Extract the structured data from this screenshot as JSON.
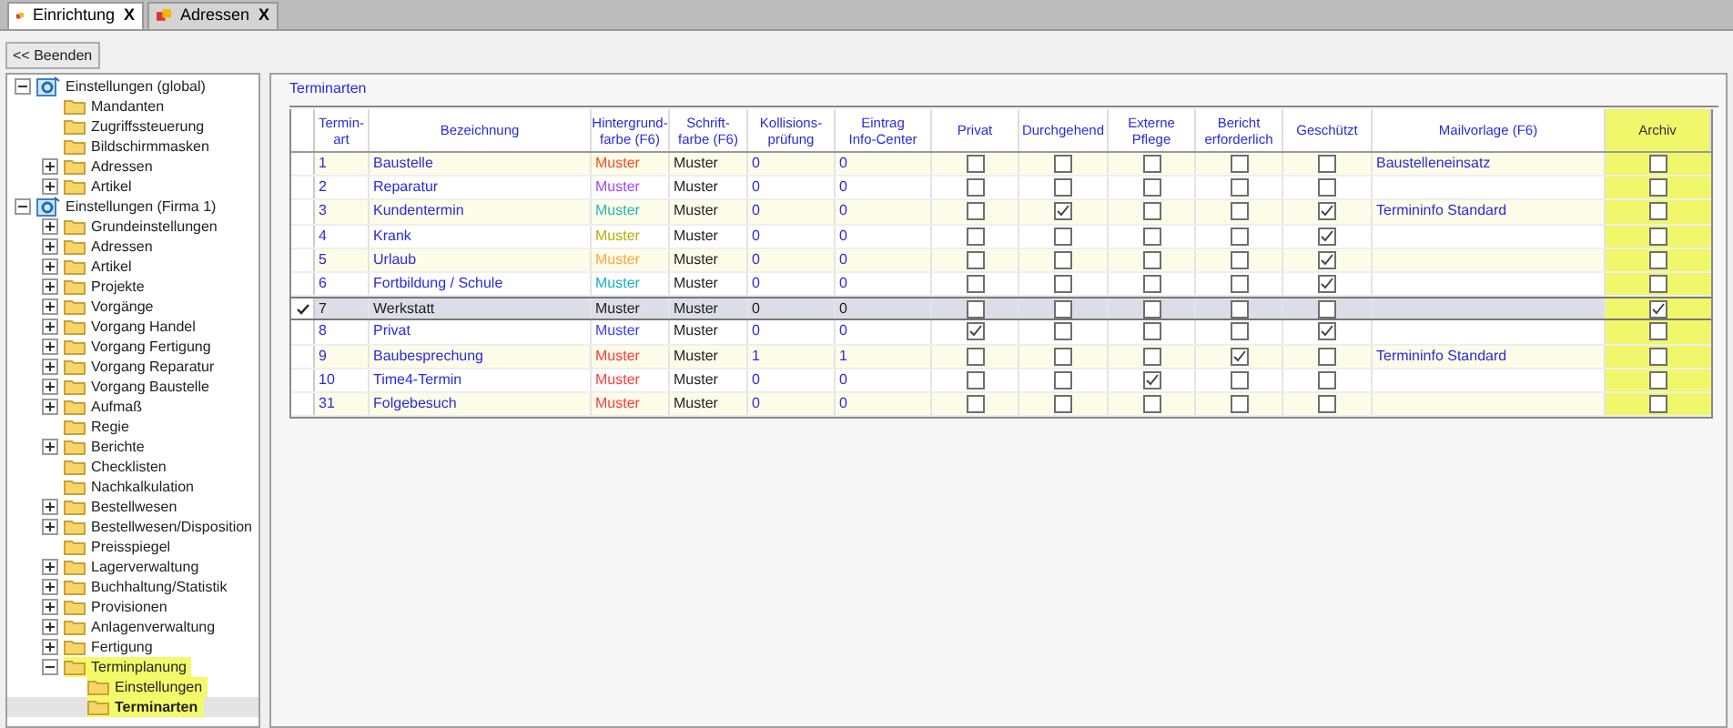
{
  "tabs": [
    {
      "label": "Einrichtung",
      "close": "X",
      "selected": true
    },
    {
      "label": "Adressen",
      "close": "X",
      "selected": false
    }
  ],
  "back_button": "<< Beenden",
  "tree": [
    {
      "label": "Einstellungen (global)",
      "kind": "root",
      "expanded": true,
      "selected": false,
      "highlighted": false,
      "children": [
        {
          "label": "Mandanten",
          "kind": "folder",
          "selected": false,
          "highlighted": false
        },
        {
          "label": "Zugriffssteuerung",
          "kind": "folder",
          "selected": false,
          "highlighted": false
        },
        {
          "label": "Bildschirmmasken",
          "kind": "folder",
          "selected": false,
          "highlighted": false
        },
        {
          "label": "Adressen",
          "kind": "folder",
          "expanded": false,
          "selected": false,
          "highlighted": false
        },
        {
          "label": "Artikel",
          "kind": "folder",
          "expanded": false,
          "selected": false,
          "highlighted": false
        }
      ]
    },
    {
      "label": "Einstellungen (Firma 1)",
      "kind": "root",
      "expanded": true,
      "selected": false,
      "highlighted": false,
      "children": [
        {
          "label": "Grundeinstellungen",
          "kind": "folder",
          "expanded": false,
          "selected": false,
          "highlighted": false
        },
        {
          "label": "Adressen",
          "kind": "folder",
          "expanded": false,
          "selected": false,
          "highlighted": false
        },
        {
          "label": "Artikel",
          "kind": "folder",
          "expanded": false,
          "selected": false,
          "highlighted": false
        },
        {
          "label": "Projekte",
          "kind": "folder",
          "expanded": false,
          "selected": false,
          "highlighted": false
        },
        {
          "label": "Vorgänge",
          "kind": "folder",
          "expanded": false,
          "selected": false,
          "highlighted": false
        },
        {
          "label": "Vorgang Handel",
          "kind": "folder",
          "expanded": false,
          "selected": false,
          "highlighted": false
        },
        {
          "label": "Vorgang Fertigung",
          "kind": "folder",
          "expanded": false,
          "selected": false,
          "highlighted": false
        },
        {
          "label": "Vorgang Reparatur",
          "kind": "folder",
          "expanded": false,
          "selected": false,
          "highlighted": false
        },
        {
          "label": "Vorgang Baustelle",
          "kind": "folder",
          "expanded": false,
          "selected": false,
          "highlighted": false
        },
        {
          "label": "Aufmaß",
          "kind": "folder",
          "expanded": false,
          "selected": false,
          "highlighted": false
        },
        {
          "label": "Regie",
          "kind": "folder",
          "selected": false,
          "highlighted": false
        },
        {
          "label": "Berichte",
          "kind": "folder",
          "expanded": false,
          "selected": false,
          "highlighted": false
        },
        {
          "label": "Checklisten",
          "kind": "folder",
          "selected": false,
          "highlighted": false
        },
        {
          "label": "Nachkalkulation",
          "kind": "folder",
          "selected": false,
          "highlighted": false
        },
        {
          "label": "Bestellwesen",
          "kind": "folder",
          "expanded": false,
          "selected": false,
          "highlighted": false
        },
        {
          "label": "Bestellwesen/Disposition",
          "kind": "folder",
          "expanded": false,
          "selected": false,
          "highlighted": false
        },
        {
          "label": "Preisspiegel",
          "kind": "folder",
          "selected": false,
          "highlighted": false
        },
        {
          "label": "Lagerverwaltung",
          "kind": "folder",
          "expanded": false,
          "selected": false,
          "highlighted": false
        },
        {
          "label": "Buchhaltung/Statistik",
          "kind": "folder",
          "expanded": false,
          "selected": false,
          "highlighted": false
        },
        {
          "label": "Provisionen",
          "kind": "folder",
          "expanded": false,
          "selected": false,
          "highlighted": false
        },
        {
          "label": "Anlagenverwaltung",
          "kind": "folder",
          "expanded": false,
          "selected": false,
          "highlighted": false
        },
        {
          "label": "Fertigung",
          "kind": "folder",
          "expanded": false,
          "selected": false,
          "highlighted": false
        },
        {
          "label": "Terminplanung",
          "kind": "folder",
          "expanded": true,
          "selected": false,
          "highlighted": true,
          "children": [
            {
              "label": "Einstellungen",
              "kind": "folder",
              "selected": false,
              "highlighted": true
            },
            {
              "label": "Terminarten",
              "kind": "folder",
              "selected": true,
              "highlighted": true
            }
          ]
        }
      ]
    }
  ],
  "grid": {
    "title": "Terminarten",
    "columns": [
      {
        "label": "Termin-\nart",
        "highlighted": false
      },
      {
        "label": "Bezeichnung",
        "highlighted": false
      },
      {
        "label": "Hintergrund-\nfarbe (F6)",
        "highlighted": false
      },
      {
        "label": "Schrift-\nfarbe (F6)",
        "highlighted": false
      },
      {
        "label": "Kollisions-\nprüfung",
        "highlighted": false
      },
      {
        "label": "Eintrag\nInfo-Center",
        "highlighted": false
      },
      {
        "label": "Privat",
        "highlighted": false
      },
      {
        "label": "Durchgehend",
        "highlighted": false
      },
      {
        "label": "Externe\nPflege",
        "highlighted": false
      },
      {
        "label": "Bericht\nerforderlich",
        "highlighted": false
      },
      {
        "label": "Geschützt",
        "highlighted": false
      },
      {
        "label": "Mailvorlage (F6)",
        "highlighted": false
      },
      {
        "label": "Archiv",
        "highlighted": true
      }
    ],
    "rows": [
      {
        "nr": "1",
        "name": "Baustelle",
        "bg": {
          "text": "Muster",
          "color": "#ff4a1c"
        },
        "font": {
          "text": "Muster",
          "color": "#222222"
        },
        "kollision": "0",
        "info": "0",
        "checks": [
          false,
          false,
          false,
          false,
          false,
          false
        ],
        "mail": "Baustelleneinsatz",
        "selected": false
      },
      {
        "nr": "2",
        "name": "Reparatur",
        "bg": {
          "text": "Muster",
          "color": "#a347ff"
        },
        "font": {
          "text": "Muster",
          "color": "#222222"
        },
        "kollision": "0",
        "info": "0",
        "checks": [
          false,
          false,
          false,
          false,
          false,
          false
        ],
        "selected": false
      },
      {
        "nr": "3",
        "name": "Kundentermin",
        "bg": {
          "text": "Muster",
          "color": "#1fb8b8"
        },
        "font": {
          "text": "Muster",
          "color": "#222222"
        },
        "kollision": "0",
        "info": "0",
        "checks": [
          false,
          true,
          false,
          false,
          true,
          false
        ],
        "mail": "Termininfo Standard",
        "selected": false
      },
      {
        "nr": "4",
        "name": "Krank",
        "bg": {
          "text": "Muster",
          "color": "#b8b000"
        },
        "font": {
          "text": "Muster",
          "color": "#222222"
        },
        "kollision": "0",
        "info": "0",
        "checks": [
          false,
          false,
          false,
          false,
          true,
          false
        ],
        "selected": false
      },
      {
        "nr": "5",
        "name": "Urlaub",
        "bg": {
          "text": "Muster",
          "color": "#ffa640"
        },
        "font": {
          "text": "Muster",
          "color": "#222222"
        },
        "kollision": "0",
        "info": "0",
        "checks": [
          false,
          false,
          false,
          false,
          true,
          false
        ],
        "selected": false
      },
      {
        "nr": "6",
        "name": "Fortbildung / Schule",
        "bg": {
          "text": "Muster",
          "color": "#12b4c4"
        },
        "font": {
          "text": "Muster",
          "color": "#222222"
        },
        "kollision": "0",
        "info": "0",
        "checks": [
          false,
          false,
          false,
          false,
          true,
          false
        ],
        "selected": false
      },
      {
        "nr": "7",
        "name": "Werkstatt",
        "bg": {
          "text": "Muster",
          "color": "#222222"
        },
        "font": {
          "text": "Muster",
          "color": "#222222"
        },
        "kollision": "0",
        "info": "0",
        "checks": [
          false,
          false,
          false,
          false,
          false,
          true
        ],
        "selected": true
      },
      {
        "nr": "8",
        "name": "Privat",
        "bg": {
          "text": "Muster",
          "color": "#3b3bff"
        },
        "font": {
          "text": "Muster",
          "color": "#222222"
        },
        "kollision": "0",
        "info": "0",
        "checks": [
          true,
          false,
          false,
          false,
          true,
          false
        ],
        "selected": false
      },
      {
        "nr": "9",
        "name": "Baubesprechung",
        "bg": {
          "text": "Muster",
          "color": "#ff3b3b"
        },
        "font": {
          "text": "Muster",
          "color": "#222222"
        },
        "kollision": "1",
        "info": "1",
        "checks": [
          false,
          false,
          false,
          true,
          false,
          false
        ],
        "mail": "Termininfo Standard",
        "selected": false
      },
      {
        "nr": "10",
        "name": "Time4-Termin",
        "bg": {
          "text": "Muster",
          "color": "#ff3b3b"
        },
        "font": {
          "text": "Muster",
          "color": "#222222"
        },
        "kollision": "0",
        "info": "0",
        "checks": [
          false,
          false,
          true,
          false,
          false,
          false
        ],
        "selected": false
      },
      {
        "nr": "31",
        "name": "Folgebesuch",
        "bg": {
          "text": "Muster",
          "color": "#ff3b3b"
        },
        "font": {
          "text": "Muster",
          "color": "#222222"
        },
        "kollision": "0",
        "info": "0",
        "checks": [
          false,
          false,
          false,
          false,
          false,
          false
        ],
        "selected": false
      }
    ]
  }
}
